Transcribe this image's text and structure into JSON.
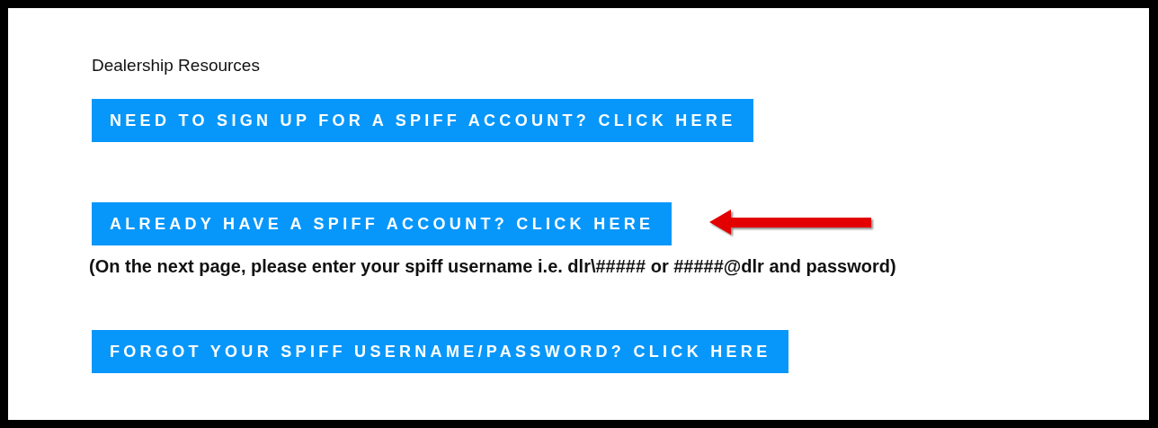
{
  "heading": "Dealership Resources",
  "items": [
    {
      "kind": "button",
      "label": "NEED TO SIGN UP FOR A SPIFF ACCOUNT? CLICK HERE",
      "pointer_arrow": false
    },
    {
      "kind": "button",
      "label": "ALREADY HAVE A SPIFF ACCOUNT? CLICK HERE",
      "pointer_arrow": true
    },
    {
      "kind": "note",
      "text": "(On the next page, please enter your spiff username i.e. dlr\\##### or #####@dlr and password)"
    },
    {
      "kind": "button",
      "label": "FORGOT YOUR SPIFF USERNAME/PASSWORD? CLICK HERE",
      "pointer_arrow": false
    }
  ]
}
